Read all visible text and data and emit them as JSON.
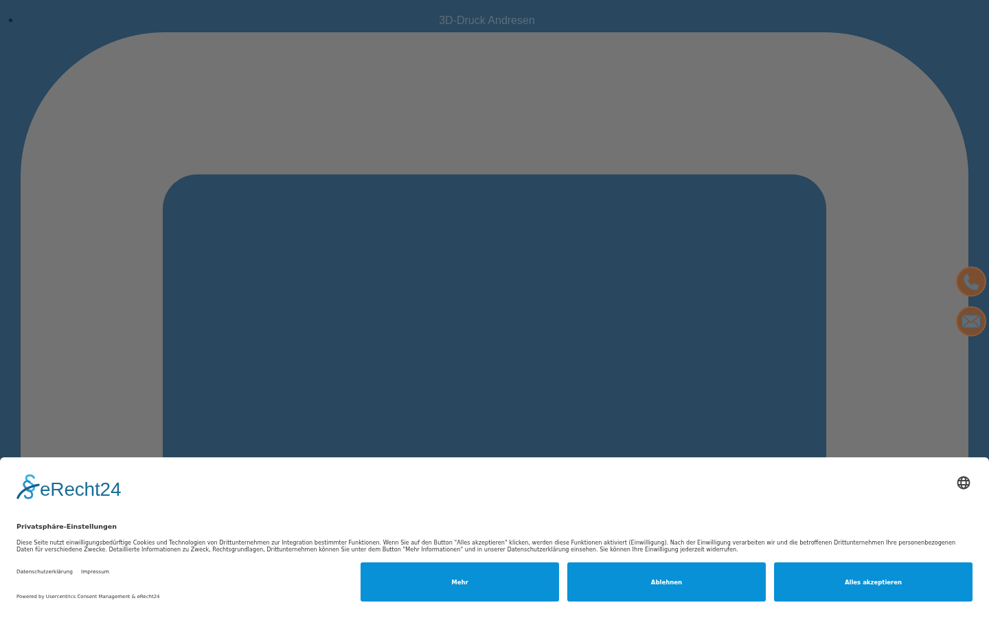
{
  "header": {
    "title": "3D-Druck Andresen"
  },
  "contact_buttons": [
    {
      "kind": "phone"
    },
    {
      "kind": "mail"
    }
  ],
  "consent_banner": {
    "logo": {
      "text": "eRecht24"
    },
    "heading": "Privatsphäre-Einstellungen",
    "description": "Diese Seite nutzt einwilligungsbedürftige Cookies und Technologien von Drittunternehmen zur Integration bestimmter Funktionen. Wenn Sie auf den Button \"Alles akzeptieren\" klicken, werden diese Funktionen aktiviert (Einwilligung). Nach der Einwilligung verarbeiten wir und die betroffenen Drittunternehmen Ihre personenbezogenen Daten für verschiedene Zwecke. Detaillierte Informationen zu Zweck, Rechtsgrundlagen, Drittunternehmen können Sie unter dem Button \"Mehr Informationen\" und in unserer Datenschutzerklärung einsehen. Sie können Ihre Einwilligung jederzeit widerrufen.",
    "links": [
      "Datenschutzerklärung",
      "Impressum"
    ],
    "powered_by": "Powered by Usercentrics Consent Management & eRecht24",
    "buttons": [
      "Mehr",
      "Ablehnen",
      "Alles akzeptieren"
    ]
  }
}
